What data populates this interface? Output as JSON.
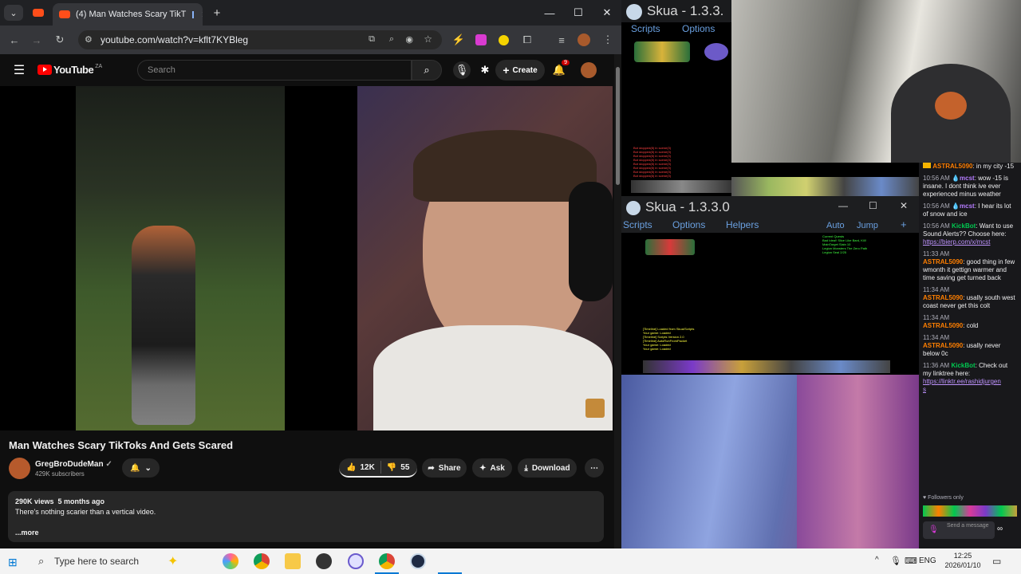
{
  "browser": {
    "tab_title": "(4) Man Watches Scary TikT",
    "url": "youtube.com/watch?v=kflt7KYBleg",
    "icons": [
      "chevron-down-icon",
      "youtube-tab-icon",
      "close-icon",
      "plus-icon",
      "minimize-icon",
      "maximize-icon",
      "close-icon",
      "back-icon",
      "forward-icon",
      "reload-icon",
      "site-info-icon",
      "install-icon",
      "zoom-icon",
      "eye-off-icon",
      "star-icon",
      "extensions-icon",
      "menu-icon"
    ]
  },
  "youtube": {
    "logo_text": "YouTube",
    "logo_region": "ZA",
    "search_placeholder": "Search",
    "create_label": "Create",
    "notification_count": "9",
    "video_title": "Man Watches Scary TikToks And Gets Scared",
    "channel_name": "GregBroDudeMan",
    "subscribers": "429K subscribers",
    "likes": "12K",
    "dislikes": "55",
    "share_label": "Share",
    "ask_label": "Ask",
    "download_label": "Download",
    "views_line": "290K views  5 months ago",
    "description": "There's nothing scarier than a vertical video.",
    "more_label": "...more"
  },
  "skua1": {
    "title": "Skua - 1.3.3.",
    "menu": [
      "Scripts",
      "Options"
    ],
    "log_lines": [
      "Bot stopped(8) in  scene(0)",
      "Bot stopped(8) in  scene(0)",
      "Bot stopped(8) in  scene(0)",
      "Bot stopped(8) in  scene(0)",
      "Bot stopped(8) in  scene(0)",
      "Bot stopped(8) in  scene(0)",
      "Bot stopped(8) in  scene(0)",
      "Bot stopped(8) in  scene(0)"
    ]
  },
  "skua2": {
    "title": "Skua - 1.3.3.0",
    "menu": [
      "Scripts",
      "Options",
      "Helpers"
    ],
    "right_menu": [
      "Auto",
      "Jump"
    ],
    "add_label": "+",
    "quest_lines": [
      "Current Quests",
      "Bad Idea!! Slice Like Bard, Kill!",
      "MainTarget Slain 10",
      "Legion Monsters The Zero Path",
      "Legion Seal 2/25"
    ],
    "log_lines": [
      "[Timeline] Loaded from Skua/Scripts",
      "Your game: Loaded",
      "[Timeline] Scripts Version 2.0",
      "[Timeline] AutoRunFromPacket",
      "Your game: Loaded",
      "Your game: Loaded"
    ]
  },
  "chat": {
    "messages": [
      {
        "time": "",
        "user": "ASTRAL5090",
        "color": "#ff7f00",
        "text": ": in my city -15"
      },
      {
        "time": "10:56 AM",
        "user": "mcst",
        "color": "#b57cff",
        "text": ": wow -15 is insane. I dont think ive ever experienced minus weather"
      },
      {
        "time": "10:56 AM",
        "user": "mcst",
        "color": "#b57cff",
        "text": ": I hear its lot of snow and ice"
      },
      {
        "time": "10:56 AM",
        "user": "KickBot",
        "color": "#00c850",
        "text": ": Want to use Sound Alerts?? Choose here:",
        "link": "https://bierp.com/x/mcst"
      },
      {
        "time": "11:33 AM",
        "user": "ASTRAL5090",
        "color": "#ff7f00",
        "text": ": good thing in few wmonth it gettign warmer and time saving get turned back"
      },
      {
        "time": "11:34 AM",
        "user": "ASTRAL5090",
        "color": "#ff7f00",
        "text": ": usally south west coast never get this colt"
      },
      {
        "time": "11:34 AM",
        "user": "ASTRAL5090",
        "color": "#ff7f00",
        "text": ": cold"
      },
      {
        "time": "11:34 AM",
        "user": "ASTRAL5090",
        "color": "#ff7f00",
        "text": ": usally never below 0c"
      },
      {
        "time": "11:36 AM",
        "user": "KickBot",
        "color": "#00c850",
        "text": ": Check out my linktree here:",
        "link": "https://linktr.ee/rashidjurgen"
      }
    ],
    "link_suffix": "s",
    "followers_only": "Followers only",
    "send_placeholder": "Send a message"
  },
  "taskbar": {
    "search_placeholder": "Type here to search",
    "lang": "ENG",
    "time": "12:25",
    "date": "2026/01/10",
    "icons": [
      "windows-icon",
      "search-icon",
      "copilot-icon",
      "chrome-icon",
      "file-explorer-icon",
      "obs-icon",
      "snipping-tool-icon",
      "chrome-icon",
      "skua-icon"
    ]
  },
  "colors": {
    "yt_red": "#ff0000",
    "accent": "#3ea6ff",
    "taskbar": "#f3f3f3"
  }
}
